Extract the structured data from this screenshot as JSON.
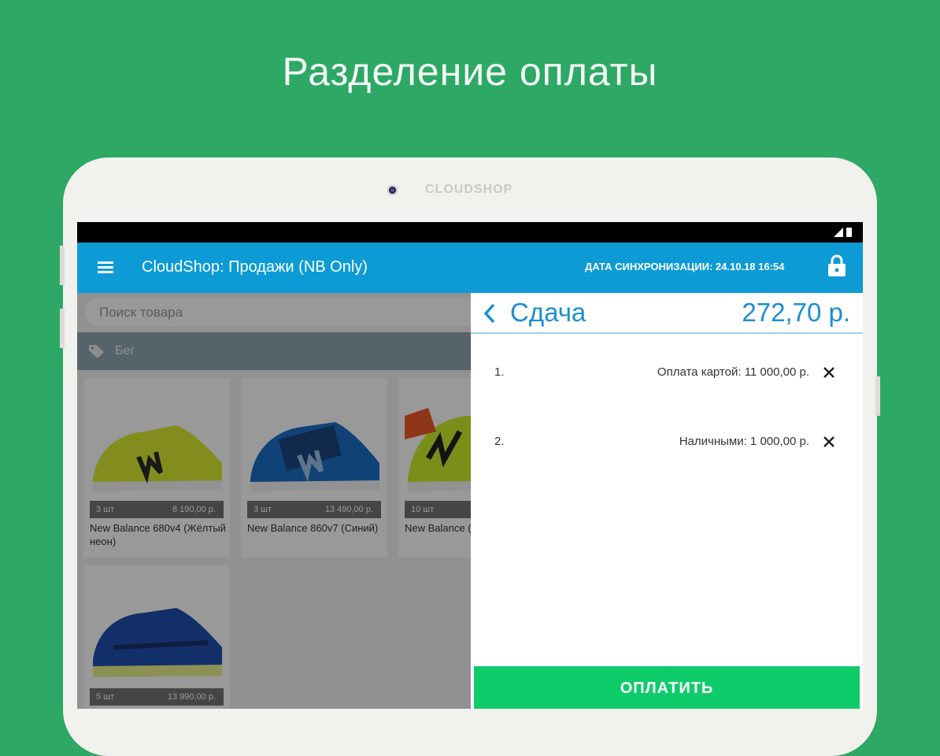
{
  "promo": {
    "title": "Разделение оплаты"
  },
  "device": {
    "brand": "CLOUDSHOP"
  },
  "appbar": {
    "title": "CloudShop: Продажи (NB Only)",
    "sync": "ДАТА СИНХРОНИЗАЦИИ: 24.10.18 16:54"
  },
  "search": {
    "placeholder": "Поиск товара"
  },
  "category": {
    "label": "Бег"
  },
  "products": [
    {
      "qty": "3 шт",
      "price": "8 190,00 р.",
      "name": "New Balance 680v4 (Жёлтый неон)",
      "colors": [
        "#d9ec32",
        "#2b2b2b"
      ]
    },
    {
      "qty": "3 шт",
      "price": "13 490,00 р.",
      "name": "New Balance 860v7 (Синий)",
      "colors": [
        "#1d6fc7",
        "#1b2a4f"
      ]
    },
    {
      "qty": "10 шт",
      "price": "",
      "name": "New Balance (Жёлтый неон)",
      "colors": [
        "#ccee2a",
        "#222222"
      ]
    },
    {
      "qty": "5 шт",
      "price": "13 990,00 р.",
      "name": "",
      "colors": [
        "#1f4fb0",
        "#1a2f6b"
      ]
    }
  ],
  "panel": {
    "title": "Сдача",
    "amount": "272,70 р.",
    "payments": [
      {
        "num": "1.",
        "text": "Оплата картой: 11 000,00 р."
      },
      {
        "num": "2.",
        "text": "Наличными: 1 000,00 р."
      }
    ],
    "pay_button": "ОПЛАТИТЬ"
  },
  "colors": {
    "background": "#2ea865",
    "appbar": "#0d9bd5",
    "accent": "#1a8fcf",
    "pay_button": "#0fcc6b"
  }
}
